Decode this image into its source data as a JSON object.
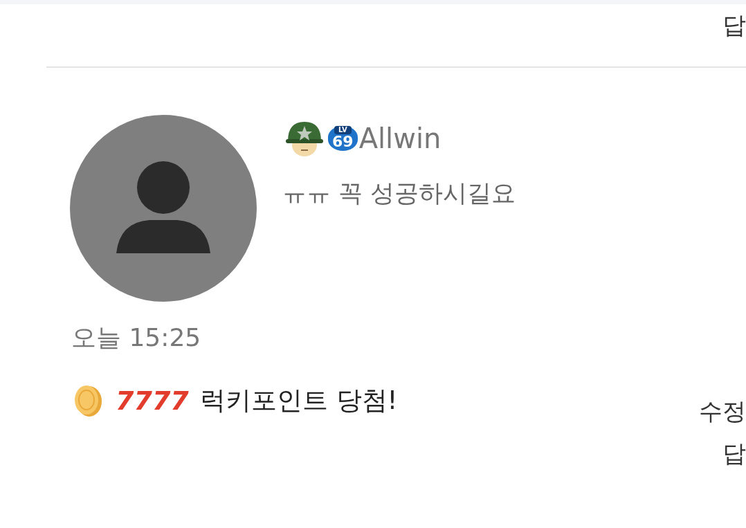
{
  "top_actions": [
    {
      "label": "답"
    }
  ],
  "comment": {
    "author": {
      "name": "Allwin",
      "level_badge": {
        "label": "LV",
        "level": "69"
      }
    },
    "text": "ㅠㅠ 꼭 성공하시길요",
    "time": "오늘 15:25"
  },
  "lucky_point": {
    "amount": "7777",
    "text": "럭키포인트 당첨!"
  },
  "actions": [
    {
      "label": "수정"
    },
    {
      "label": "답"
    }
  ]
}
